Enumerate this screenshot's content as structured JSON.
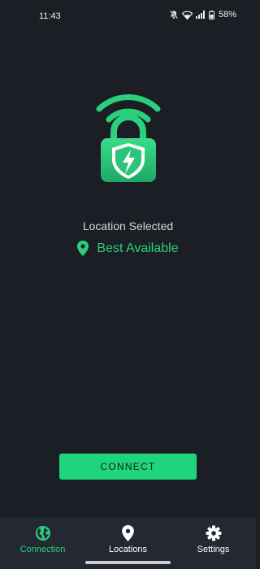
{
  "status_bar": {
    "time": "11:43",
    "battery": "58%",
    "icons": [
      "mute-icon",
      "wifi-icon",
      "signal-icon",
      "battery-icon"
    ]
  },
  "main": {
    "location_label": "Location Selected",
    "location_value": "Best Available",
    "connect_label": "CONNECT"
  },
  "nav": {
    "items": [
      {
        "label": "Connection",
        "icon": "globe-icon",
        "active": true
      },
      {
        "label": "Locations",
        "icon": "location-pin-icon",
        "active": false
      },
      {
        "label": "Settings",
        "icon": "gear-icon",
        "active": false
      }
    ]
  },
  "colors": {
    "background": "#1b1e25",
    "accent": "#1fd57b",
    "nav_background": "#242833"
  }
}
